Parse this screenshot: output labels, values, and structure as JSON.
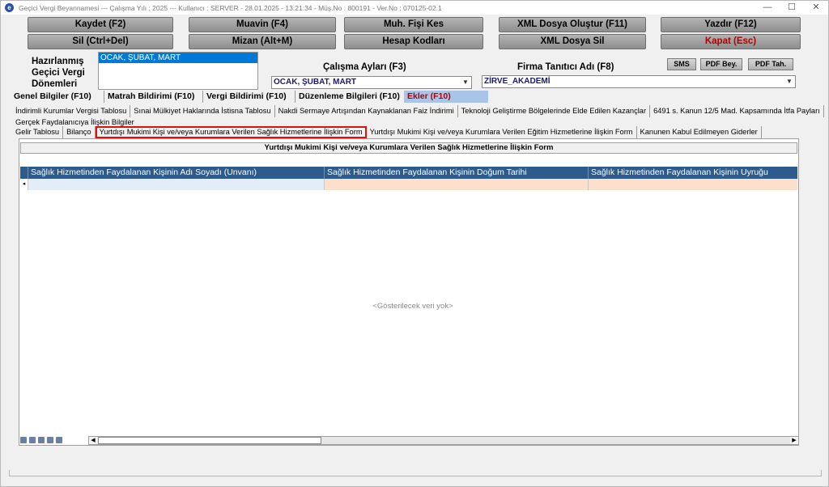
{
  "titlebar": {
    "text": "Geçici Vergi Beyannamesi  ---  Çalışma Yılı : 2025  ---  Kullanıcı : SERVER - 28.01.2025 - 13:21:34 - Müş.No : 800191 - Ver.No : 070125-02.1",
    "minimize": "—",
    "maximize": "☐",
    "close": "✕"
  },
  "toolbar": {
    "kaydet": "Kaydet (F2)",
    "muavin": "Muavin (F4)",
    "muh_fisi": "Muh. Fişi Kes",
    "xml_olustur": "XML Dosya Oluştur (F11)",
    "yazdir": "Yazdır (F12)",
    "sil": "Sil (Ctrl+Del)",
    "mizan": "Mizan (Alt+M)",
    "hesap_kodlari": "Hesap Kodları",
    "xml_sil": "XML Dosya Sil",
    "kapat": "Kapat (Esc)"
  },
  "header": {
    "prepared_label_1": "Hazırlanmış",
    "prepared_label_2": "Geçici Vergi",
    "prepared_label_3": "Dönemleri",
    "prepared_value": "OCAK, ŞUBAT, MART",
    "periods_label": "Çalışma Ayları (F3)",
    "periods_value": "OCAK, ŞUBAT, MART",
    "firm_label": "Firma Tanıtıcı Adı (F8)",
    "firm_value": "ZİRVE_AKADEMİ",
    "sms": "SMS",
    "pdf_bey": "PDF Bey.",
    "pdf_tah": "PDF Tah."
  },
  "main_tabs": [
    "Genel Bilgiler (F10)",
    "Matrah Bildirimi (F10)",
    "Vergi Bildirimi (F10)",
    "Düzenleme Bilgileri (F10)",
    "Ekler (F10)"
  ],
  "sub_tabs_row1": [
    "İndirimli Kurumlar Vergisi Tablosu",
    "Sınai Mülkiyet Haklarında İstisna Tablosu",
    "Nakdi Sermaye Artışından Kaynaklanan Faiz İndirimi",
    "Teknoloji Geliştirme Bölgelerinde Elde Edilen Kazançlar",
    "6491 s. Kanun 12/5 Mad. Kapsamında İtfa Payları"
  ],
  "sub_tabs_row2": [
    "Gerçek Faydalanıcıya İlişkin Bilgiler"
  ],
  "sub_tabs_row3": [
    "Gelir Tablosu",
    "Bilanço",
    "Yurtdışı Mukimi Kişi ve/veya Kurumlara Verilen Sağlık Hizmetlerine İlişkin Form",
    "Yurtdışı Mukimi Kişi ve/veya Kurumlara Verilen Eğitim Hizmetlerine İlişkin Form",
    "Kanunen Kabul Edilmeyen Giderler"
  ],
  "form": {
    "title": "Yurtdışı Mukimi Kişi ve/veya Kurumlara Verilen Sağlık Hizmetlerine İlişkin Form",
    "columns": [
      "Sağlık Hizmetinden Faydalanan Kişinin Adı Soyadı (Unvanı)",
      "Sağlık Hizmetinden Faydalanan Kişinin Doğum Tarihi",
      "Sağlık Hizmetinden Faydalanan Kişinin Uyruğu"
    ],
    "empty_message": "<Gösterilecek veri yok>"
  },
  "colors": {
    "grid_header": "#2e5a8c",
    "row_col1": "#e4ecf8",
    "row_col2": "#fde0cc",
    "active_tab": "#a8c4e8",
    "highlight": "#e01010"
  }
}
